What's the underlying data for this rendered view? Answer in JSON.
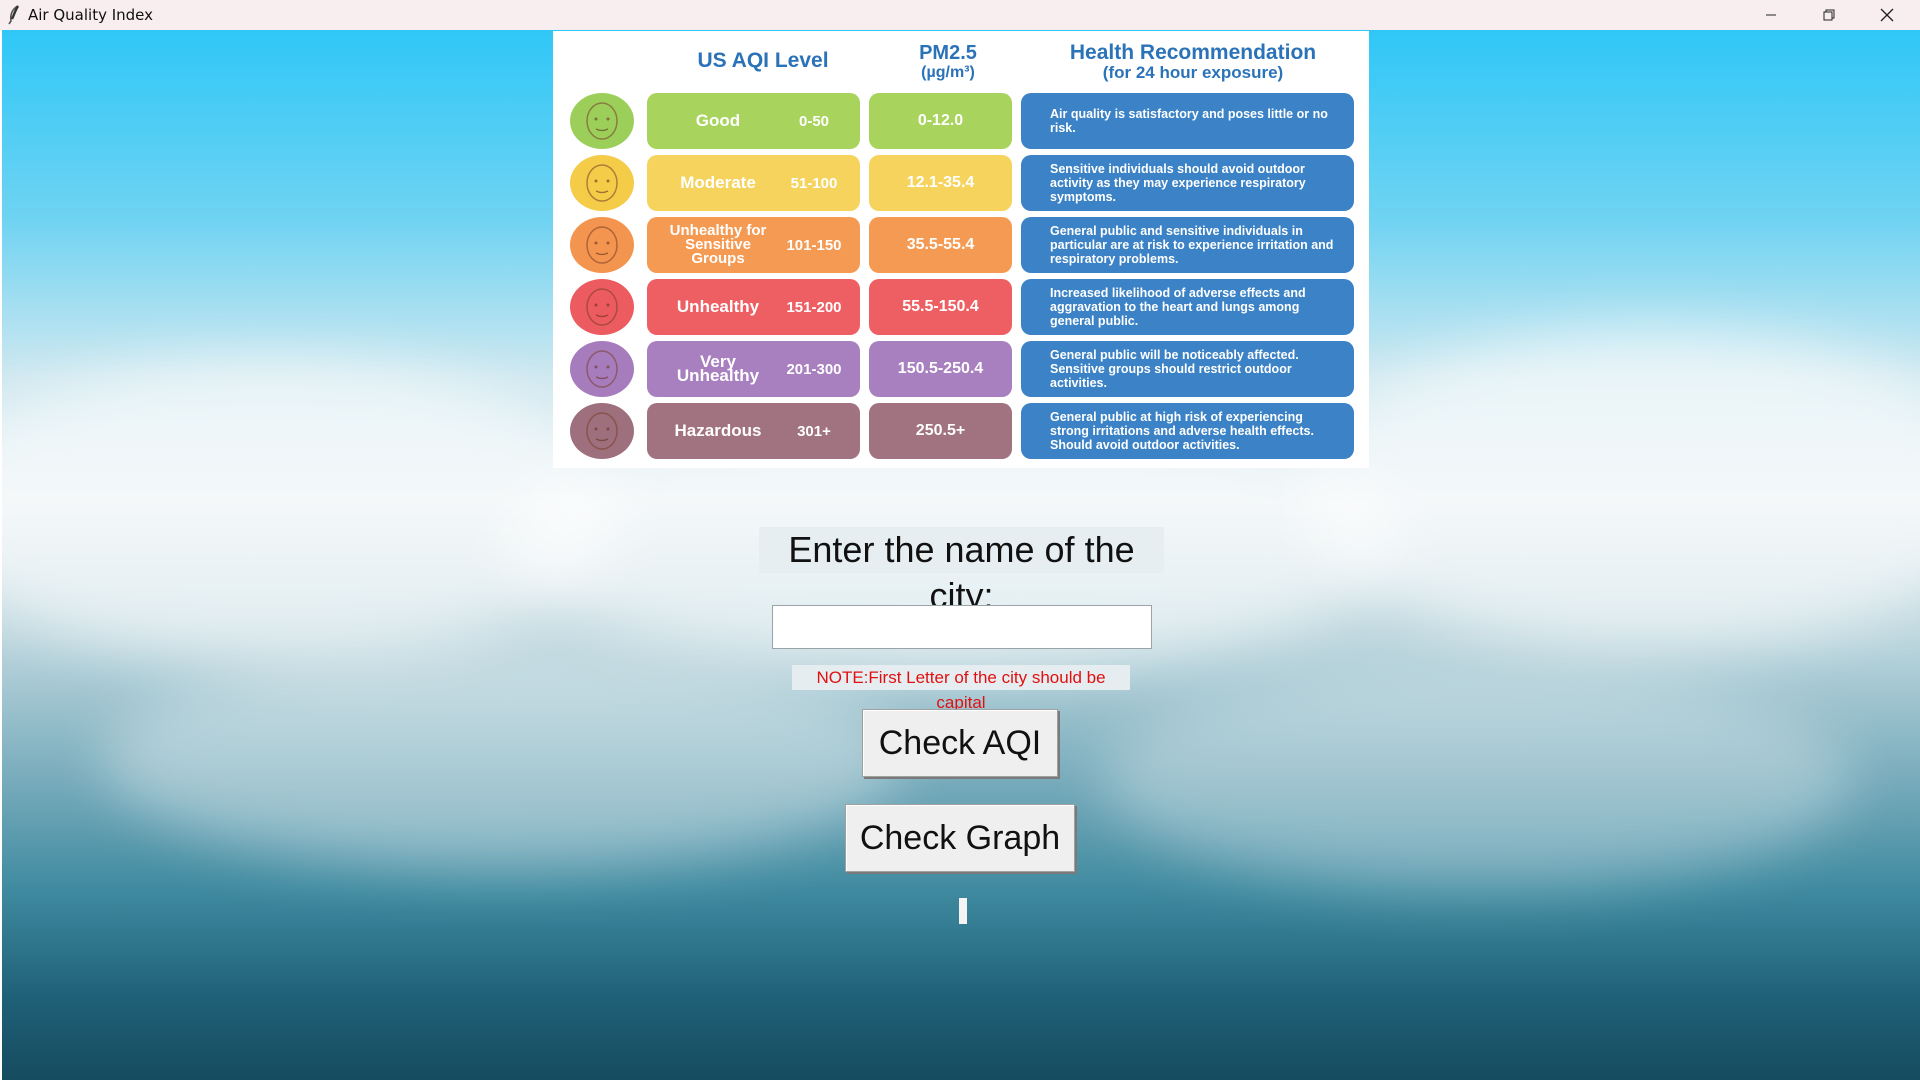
{
  "window": {
    "title": "Air Quality Index",
    "controls": [
      "minimize",
      "maximize",
      "close"
    ]
  },
  "infographic": {
    "headers": {
      "aqi_level": "US AQI Level",
      "pm_title": "PM2.5",
      "pm_unit": "(µg/m³)",
      "health_title": "Health Recommendation",
      "health_sub": "(for 24 hour exposure)"
    },
    "rows": [
      {
        "name": "Good",
        "range": "0-50",
        "pm": "0-12.0",
        "color": "#a8d35c",
        "face_color": "#9ccf5a",
        "recommendation": "Air quality is satisfactory and poses little or no risk."
      },
      {
        "name": "Moderate",
        "range": "51-100",
        "pm": "12.1-35.4",
        "color": "#f6d35d",
        "face_color": "#f4cc48",
        "recommendation": "Sensitive individuals should avoid outdoor activity as they may experience respiratory symptoms."
      },
      {
        "name": "Unhealthy for Sensitive Groups",
        "range": "101-150",
        "pm": "35.5-55.4",
        "color": "#f59a52",
        "face_color": "#f3954e",
        "recommendation": "General public and sensitive individuals in particular are at risk to experience irritation and respiratory problems."
      },
      {
        "name": "Unhealthy",
        "range": "151-200",
        "pm": "55.5-150.4",
        "color": "#ee5f63",
        "face_color": "#ec5b5f",
        "recommendation": "Increased likelihood of adverse effects and aggravation to the heart and lungs among general public."
      },
      {
        "name": "Very Unhealthy",
        "range": "201-300",
        "pm": "150.5-250.4",
        "color": "#a87fbf",
        "face_color": "#a67cbc",
        "recommendation": "General public will be noticeably affected. Sensitive groups should restrict outdoor activities."
      },
      {
        "name": "Hazardous",
        "range": "301+",
        "pm": "250.5+",
        "color": "#a1727f",
        "face_color": "#9e6f7c",
        "recommendation": "General public at high risk of experiencing strong irritations and adverse health effects. Should avoid outdoor activities."
      }
    ],
    "recommendation_color": "#3b82c6",
    "header_color": "#2b73b8"
  },
  "form": {
    "prompt": "Enter the name of the city:",
    "city_value": "",
    "note": "NOTE:First Letter of the city should be capital",
    "check_aqi_label": "Check AQI",
    "check_graph_label": "Check Graph",
    "result_text": ""
  }
}
